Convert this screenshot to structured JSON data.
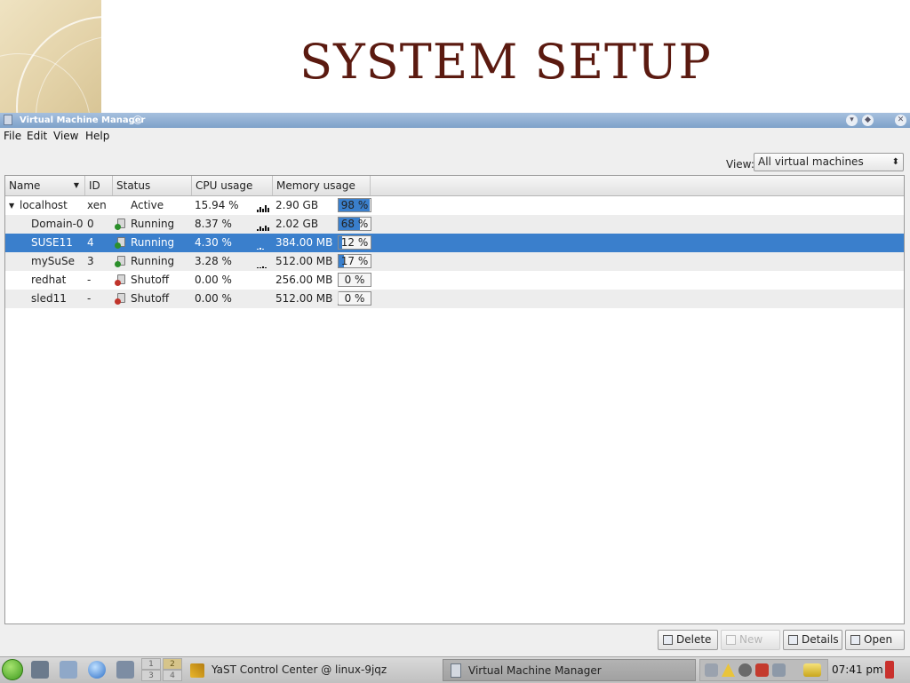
{
  "slide": {
    "title": "SYSTEM SETUP"
  },
  "window": {
    "title": "Virtual Machine Manager"
  },
  "menubar": {
    "items": [
      "File",
      "Edit",
      "View",
      "Help"
    ]
  },
  "view_filter": {
    "label": "View:",
    "value": "All virtual machines"
  },
  "table": {
    "headers": [
      "Name",
      "ID",
      "Status",
      "CPU usage",
      "Memory usage"
    ],
    "rows": [
      {
        "name": "localhost",
        "id": "xen",
        "status": "Active",
        "cpu": "15.94 %",
        "mem": "2.90 GB",
        "mem_pct_label": "98 %",
        "mem_pct": 98
      },
      {
        "name": "Domain-0",
        "id": "0",
        "status": "Running",
        "cpu": "8.37 %",
        "mem": "2.02 GB",
        "mem_pct_label": "68 %",
        "mem_pct": 68
      },
      {
        "name": "SUSE11",
        "id": "4",
        "status": "Running",
        "cpu": "4.30 %",
        "mem": "384.00 MB",
        "mem_pct_label": "12 %",
        "mem_pct": 12
      },
      {
        "name": "mySuSe",
        "id": "3",
        "status": "Running",
        "cpu": "3.28 %",
        "mem": "512.00 MB",
        "mem_pct_label": "17 %",
        "mem_pct": 17
      },
      {
        "name": "redhat",
        "id": "-",
        "status": "Shutoff",
        "cpu": "0.00 %",
        "mem": "256.00 MB",
        "mem_pct_label": "0 %",
        "mem_pct": 0
      },
      {
        "name": "sled11",
        "id": "-",
        "status": "Shutoff",
        "cpu": "0.00 %",
        "mem": "512.00 MB",
        "mem_pct_label": "0 %",
        "mem_pct": 0
      }
    ]
  },
  "buttons": {
    "delete": "Delete",
    "new": "New",
    "details": "Details",
    "open": "Open"
  },
  "taskbar": {
    "pager": [
      "1",
      "2",
      "3",
      "4"
    ],
    "tasks": [
      "YaST Control Center @ linux-9jqz",
      "Virtual Machine Manager"
    ],
    "clock": "07:41 pm"
  },
  "colors": {
    "selection": "#3a7fcc",
    "titlebar": "#7ea1c9",
    "title_text": "#5b1a10"
  }
}
